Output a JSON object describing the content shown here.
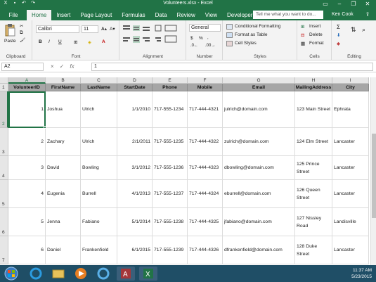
{
  "window": {
    "title": "Volunteers.xlsx - Excel"
  },
  "tabs": {
    "file": "File",
    "items": [
      "Home",
      "Insert",
      "Page Layout",
      "Formulas",
      "Data",
      "Review",
      "View",
      "Developer"
    ],
    "active": "Home",
    "tell_me": "Tell me what you want to do...",
    "user": "Ken Cook"
  },
  "ribbon": {
    "clipboard": {
      "label": "Clipboard",
      "paste": "Paste"
    },
    "font": {
      "label": "Font",
      "name": "Calibri",
      "size": "11",
      "bold": "B",
      "italic": "I",
      "underline": "U"
    },
    "alignment": {
      "label": "Alignment"
    },
    "number": {
      "label": "Number",
      "format": "General",
      "currency": "$",
      "percent": "%"
    },
    "styles": {
      "label": "Styles",
      "conditional": "Conditional Formatting",
      "table": "Format as Table",
      "cell_styles": "Cell Styles"
    },
    "cells": {
      "label": "Cells",
      "insert": "Insert",
      "delete": "Delete",
      "format": "Format"
    },
    "editing": {
      "label": "Editing"
    }
  },
  "formula_bar": {
    "name_box": "A2",
    "cancel": "×",
    "enter": "✓",
    "fx": "fx",
    "value": "1"
  },
  "grid": {
    "columns": [
      "A",
      "B",
      "C",
      "D",
      "E",
      "F",
      "G",
      "H",
      "I"
    ],
    "row_numbers": [
      "1",
      "2",
      "3",
      "4",
      "5",
      "6",
      "7"
    ],
    "headers": [
      "VolunteerID",
      "FirstName",
      "LastName",
      "StartDate",
      "Phone",
      "Mobile",
      "Email",
      "MailingAddress",
      "City"
    ],
    "rows": [
      [
        "1",
        "Joshua",
        "Ulrich",
        "1/1/2010",
        "717-555-1234",
        "717-444-4321",
        "julrich@domain.com",
        "123 Main Street",
        "Ephrata"
      ],
      [
        "2",
        "Zachary",
        "Ulrich",
        "2/1/2011",
        "717-555-1235",
        "717-444-4322",
        "zulrich@domain.com",
        "124 Elm Street",
        "Lancaster"
      ],
      [
        "3",
        "David",
        "Bowling",
        "3/1/2012",
        "717-555-1236",
        "717-444-4323",
        "dbowling@domain.com",
        "125 Prince Street",
        "Lancaster"
      ],
      [
        "4",
        "Eugenia",
        "Burrell",
        "4/1/2013",
        "717-555-1237",
        "717-444-4324",
        "eburrell@domain.com",
        "126 Queen Street",
        "Lancaster"
      ],
      [
        "5",
        "Jenna",
        "Fabiano",
        "5/1/2014",
        "717-555-1238",
        "717-444-4325",
        "jfabiano@domain.com",
        "127 Nissley Road",
        "Landisville"
      ],
      [
        "6",
        "Daniel",
        "Frankenfield",
        "6/1/2015",
        "717-555-1239",
        "717-444-4326",
        "dfrankenfield@domain.com",
        "128 Duke Street",
        "Lancaster"
      ]
    ]
  },
  "taskbar": {
    "time": "11:37 AM",
    "date": "5/23/2015"
  },
  "colors": {
    "excel_green": "#217346",
    "header_fill": "#a6a6a6",
    "taskbar": "#1f4e66"
  }
}
